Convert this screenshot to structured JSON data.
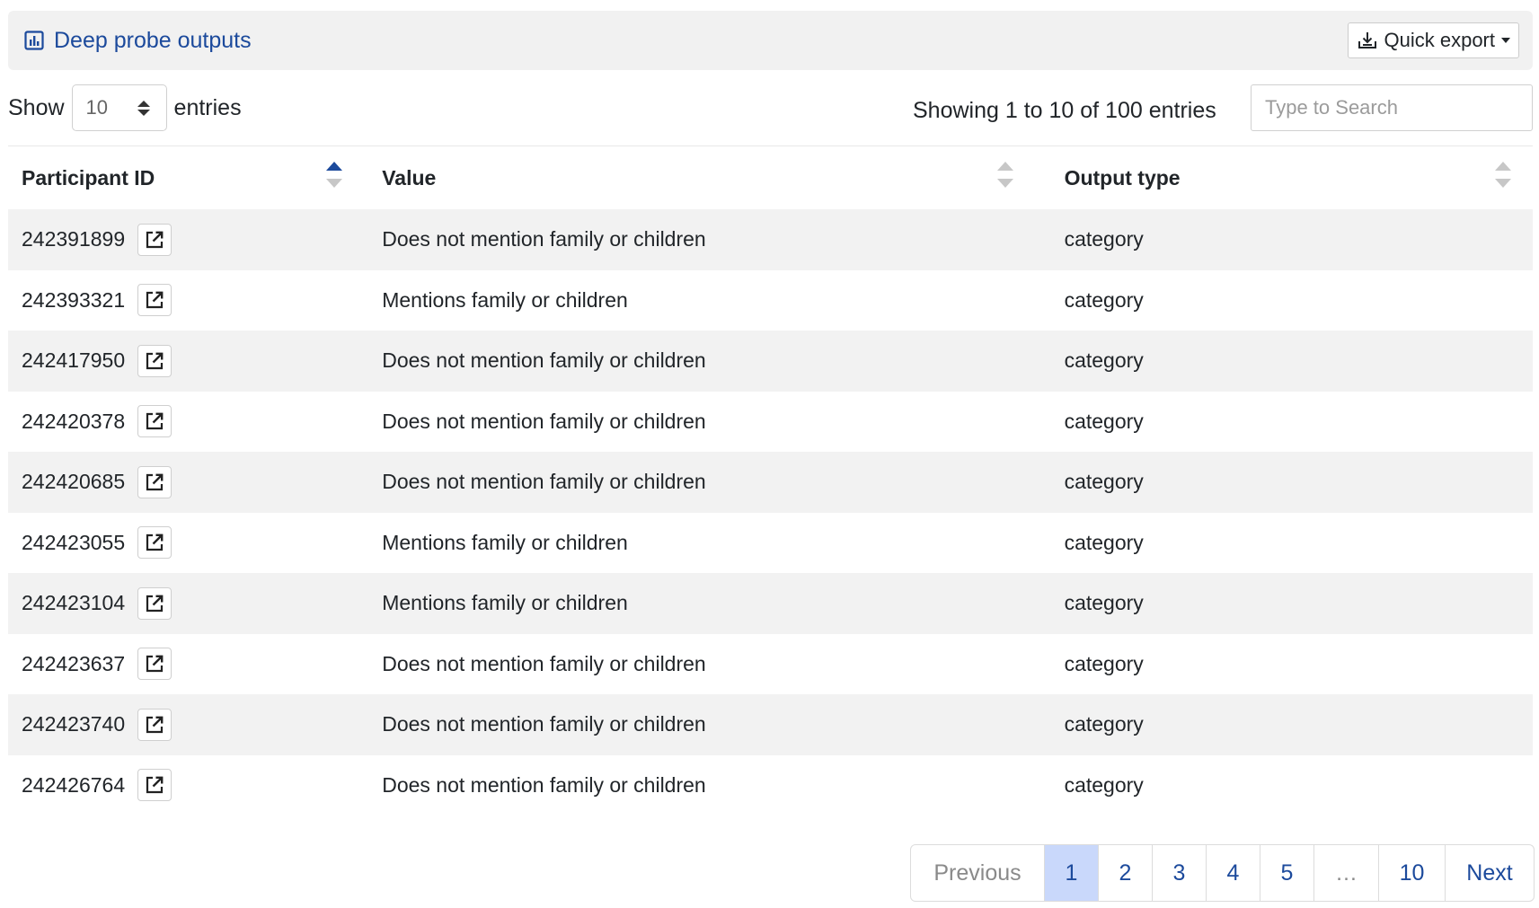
{
  "header": {
    "title": "Deep probe outputs",
    "export_label": "Quick export"
  },
  "controls": {
    "show_label": "Show",
    "page_length": "10",
    "entries_label": "entries",
    "info": "Showing 1 to 10 of 100 entries",
    "search_placeholder": "Type to Search"
  },
  "table": {
    "columns": [
      "Participant ID",
      "Value",
      "Output type"
    ],
    "sort": {
      "column": "Participant ID",
      "direction": "ascending"
    },
    "rows": [
      {
        "id": "242391899",
        "value": "Does not mention family or children",
        "type": "category"
      },
      {
        "id": "242393321",
        "value": "Mentions family or children",
        "type": "category"
      },
      {
        "id": "242417950",
        "value": "Does not mention family or children",
        "type": "category"
      },
      {
        "id": "242420378",
        "value": "Does not mention family or children",
        "type": "category"
      },
      {
        "id": "242420685",
        "value": "Does not mention family or children",
        "type": "category"
      },
      {
        "id": "242423055",
        "value": "Mentions family or children",
        "type": "category"
      },
      {
        "id": "242423104",
        "value": "Mentions family or children",
        "type": "category"
      },
      {
        "id": "242423637",
        "value": "Does not mention family or children",
        "type": "category"
      },
      {
        "id": "242423740",
        "value": "Does not mention family or children",
        "type": "category"
      },
      {
        "id": "242426764",
        "value": "Does not mention family or children",
        "type": "category"
      }
    ]
  },
  "pagination": {
    "previous": "Previous",
    "pages": [
      "1",
      "2",
      "3",
      "4",
      "5",
      "…",
      "10"
    ],
    "current": "1",
    "next": "Next"
  },
  "colors": {
    "accent": "#1c4a9c",
    "active_page": "#c9d8fb",
    "stripe": "#f2f2f2",
    "header_bg": "#f1f1f1"
  },
  "icons": {
    "title": "chart-icon",
    "export": "download-icon",
    "row_link": "external-link-icon"
  }
}
